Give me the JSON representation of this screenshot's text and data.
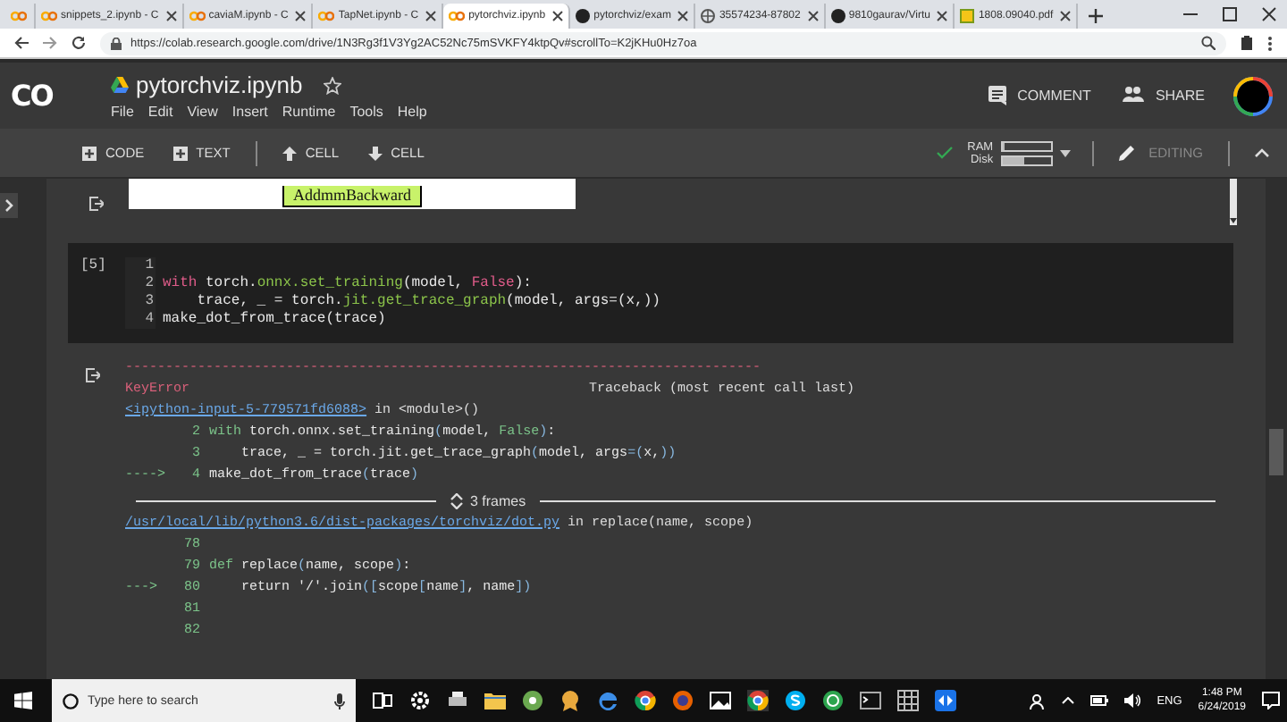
{
  "browser": {
    "tabs": [
      {
        "kind": "notebook",
        "selected": false
      },
      {
        "kind": "notebook",
        "label": "snippets_2.ipynb - C",
        "selected": false
      },
      {
        "kind": "notebook",
        "label": "caviaM.ipynb - C",
        "selected": false
      },
      {
        "kind": "notebook",
        "label": "TapNet.ipynb - C",
        "selected": false
      },
      {
        "kind": "notebook",
        "label": "pytorchviz.ipynb",
        "selected": true
      },
      {
        "kind": "repo",
        "label": "pytorchviz/exam",
        "selected": false
      },
      {
        "kind": "page",
        "label": "35574234-87802",
        "selected": false
      },
      {
        "kind": "repo",
        "label": "9810gaurav/Virtu",
        "selected": false
      },
      {
        "kind": "pdf",
        "label": "1808.09040.pdf",
        "selected": false
      }
    ],
    "url": "https://colab.research.google.com/drive/1N3Rg3f1V3Yg2AC52Nc75mSVKFY4ktpQv#scrollTo=K2jKHu0Hz7oa"
  },
  "header": {
    "logo": "CO",
    "title": "pytorchviz.ipynb",
    "menu": [
      "File",
      "Edit",
      "View",
      "Insert",
      "Runtime",
      "Tools",
      "Help"
    ],
    "actions": [
      {
        "kind": "comment",
        "label": "COMMENT"
      },
      {
        "kind": "share",
        "label": "SHARE"
      }
    ]
  },
  "toolbar": {
    "buttons": [
      {
        "kind": "add",
        "label": "CODE"
      },
      {
        "kind": "add",
        "label": "TEXT"
      },
      {
        "kind": "up",
        "label": "CELL"
      },
      {
        "kind": "down",
        "label": "CELL"
      }
    ],
    "resources": [
      {
        "label": "RAM",
        "level": 0.02
      },
      {
        "label": "Disk",
        "level": 0.45
      }
    ],
    "mode": "EDITING"
  },
  "previous_output": {
    "node": "AddmmBackward"
  },
  "cell": {
    "prompt": "[5]",
    "lines": [
      {
        "number": "1"
      },
      {
        "number": "2",
        "tokens": [
          {
            "kind": "kw",
            "text": "with"
          },
          {
            "kind": "plain",
            "text": " torch."
          },
          {
            "kind": "fn",
            "text": "onnx.set_training"
          },
          {
            "kind": "plain",
            "text": "(model, "
          },
          {
            "kind": "const",
            "text": "False"
          },
          {
            "kind": "plain",
            "text": "):"
          }
        ]
      },
      {
        "number": "3",
        "tokens": [
          {
            "kind": "plain",
            "text": "    trace, _ = torch."
          },
          {
            "kind": "fn",
            "text": "jit.get_trace_graph"
          },
          {
            "kind": "plain",
            "text": "(model, args=(x,))"
          }
        ]
      },
      {
        "number": "4",
        "tokens": [
          {
            "kind": "plain",
            "text": "make_dot_from_trace(trace)"
          }
        ]
      }
    ]
  },
  "output": {
    "lines": [
      {
        "kind": "rule",
        "text": "-------------------------------------------------------------------------------"
      },
      {
        "kind": "header",
        "error": "KeyError",
        "text": "Traceback (most recent call last)"
      },
      {
        "kind": "source",
        "link": "<ipython-input-5-779571fd6088>",
        "text": " in <module>()"
      },
      {
        "kind": "code",
        "number": "2",
        "tokens": [
          {
            "kind": "green",
            "text": "with"
          },
          {
            "kind": "plain",
            "text": " torch.onnx.set_training"
          },
          {
            "kind": "paren",
            "text": "("
          },
          {
            "kind": "plain",
            "text": "model, "
          },
          {
            "kind": "green",
            "text": "False"
          },
          {
            "kind": "paren",
            "text": ")"
          },
          {
            "kind": "plain",
            "text": ":"
          }
        ]
      },
      {
        "kind": "code",
        "number": "3",
        "tokens": [
          {
            "kind": "plain",
            "text": "    trace, _ = torch.jit.get_trace_graph"
          },
          {
            "kind": "paren",
            "text": "("
          },
          {
            "kind": "plain",
            "text": "model, args"
          },
          {
            "kind": "paren",
            "text": "=("
          },
          {
            "kind": "plain",
            "text": "x,"
          },
          {
            "kind": "paren",
            "text": "))"
          }
        ]
      },
      {
        "kind": "code",
        "marker": "---->",
        "number": "4",
        "tokens": [
          {
            "kind": "plain",
            "text": "make_dot_from_trace"
          },
          {
            "kind": "paren",
            "text": "("
          },
          {
            "kind": "plain",
            "text": "trace"
          },
          {
            "kind": "paren",
            "text": ")"
          }
        ]
      },
      {
        "kind": "frames",
        "text": "3 frames"
      },
      {
        "kind": "source",
        "link": "/usr/local/lib/python3.6/dist-packages/torchviz/dot.py",
        "text": " in replace(name, scope)"
      },
      {
        "kind": "code",
        "number": "78"
      },
      {
        "kind": "code",
        "number": "79",
        "tokens": [
          {
            "kind": "green",
            "text": "def"
          },
          {
            "kind": "plain",
            "text": " replace"
          },
          {
            "kind": "paren",
            "text": "("
          },
          {
            "kind": "plain",
            "text": "name, scope"
          },
          {
            "kind": "paren",
            "text": ")"
          },
          {
            "kind": "plain",
            "text": ":"
          }
        ]
      },
      {
        "kind": "code",
        "marker": "--->",
        "number": "80",
        "tokens": [
          {
            "kind": "plain",
            "text": "    return '/'.join"
          },
          {
            "kind": "paren",
            "text": "(["
          },
          {
            "kind": "plain",
            "text": "scope"
          },
          {
            "kind": "paren",
            "text": "["
          },
          {
            "kind": "plain",
            "text": "name"
          },
          {
            "kind": "paren",
            "text": "]"
          },
          {
            "kind": "plain",
            "text": ", name"
          },
          {
            "kind": "paren",
            "text": "])"
          }
        ]
      },
      {
        "kind": "code",
        "number": "81"
      },
      {
        "kind": "code",
        "number": "82"
      }
    ]
  },
  "taskbar": {
    "search_placeholder": "Type here to search",
    "language": "ENG",
    "time": "1:48 PM",
    "date": "6/24/2019"
  }
}
